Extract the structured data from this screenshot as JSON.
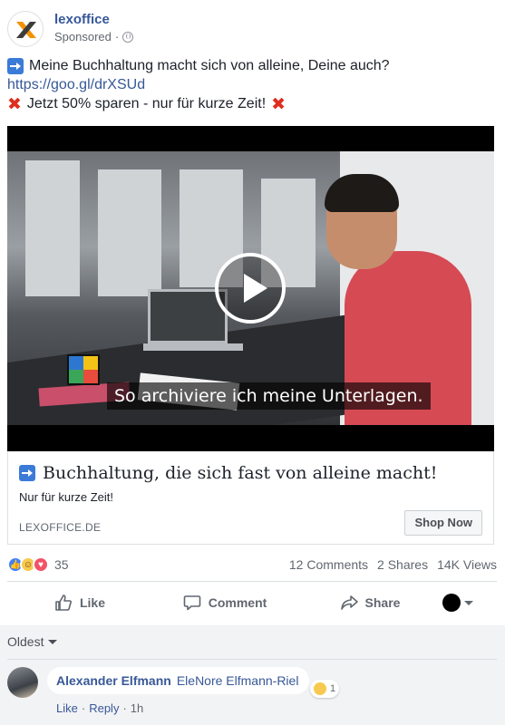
{
  "post": {
    "page_name": "lexoffice",
    "sponsored_label": "Sponsored",
    "sponsored_separator": "·",
    "text_line1": "Meine Buchhaltung macht sich von alleine, Deine auch?",
    "link": "https://goo.gl/drXSUd",
    "text_line3": "Jetzt 50% sparen - nur für kurze Zeit!"
  },
  "video": {
    "caption": "So archiviere ich meine Unterlagen."
  },
  "link_card": {
    "title": "Buchhaltung, die sich fast von alleine macht!",
    "subtitle": "Nur für kurze Zeit!",
    "domain": "LEXOFFICE.DE",
    "cta": "Shop Now"
  },
  "stats": {
    "reactions_count": "35",
    "comments": "12 Comments",
    "shares": "2 Shares",
    "views": "14K Views"
  },
  "actions": {
    "like": "Like",
    "comment": "Comment",
    "share": "Share"
  },
  "comments": {
    "sort_label": "Oldest",
    "items": [
      {
        "author": "Alexander Elfmann",
        "mention": "EleNore Elfmann-Riel",
        "reaction_count": "1",
        "like": "Like",
        "reply": "Reply",
        "separator": "·",
        "time": "1h"
      }
    ]
  },
  "colors": {
    "link_blue": "#365899",
    "like_blue": "#4080ff",
    "love_red": "#f25268",
    "haha_yellow": "#f7c94f",
    "x_red": "#dd2e1f"
  },
  "icons": [
    "lexoffice-logo-icon",
    "globe-icon",
    "arrow-right-icon",
    "cross-mark-icon",
    "play-icon",
    "like-icon",
    "comment-icon",
    "share-icon",
    "chevron-down-icon"
  ]
}
